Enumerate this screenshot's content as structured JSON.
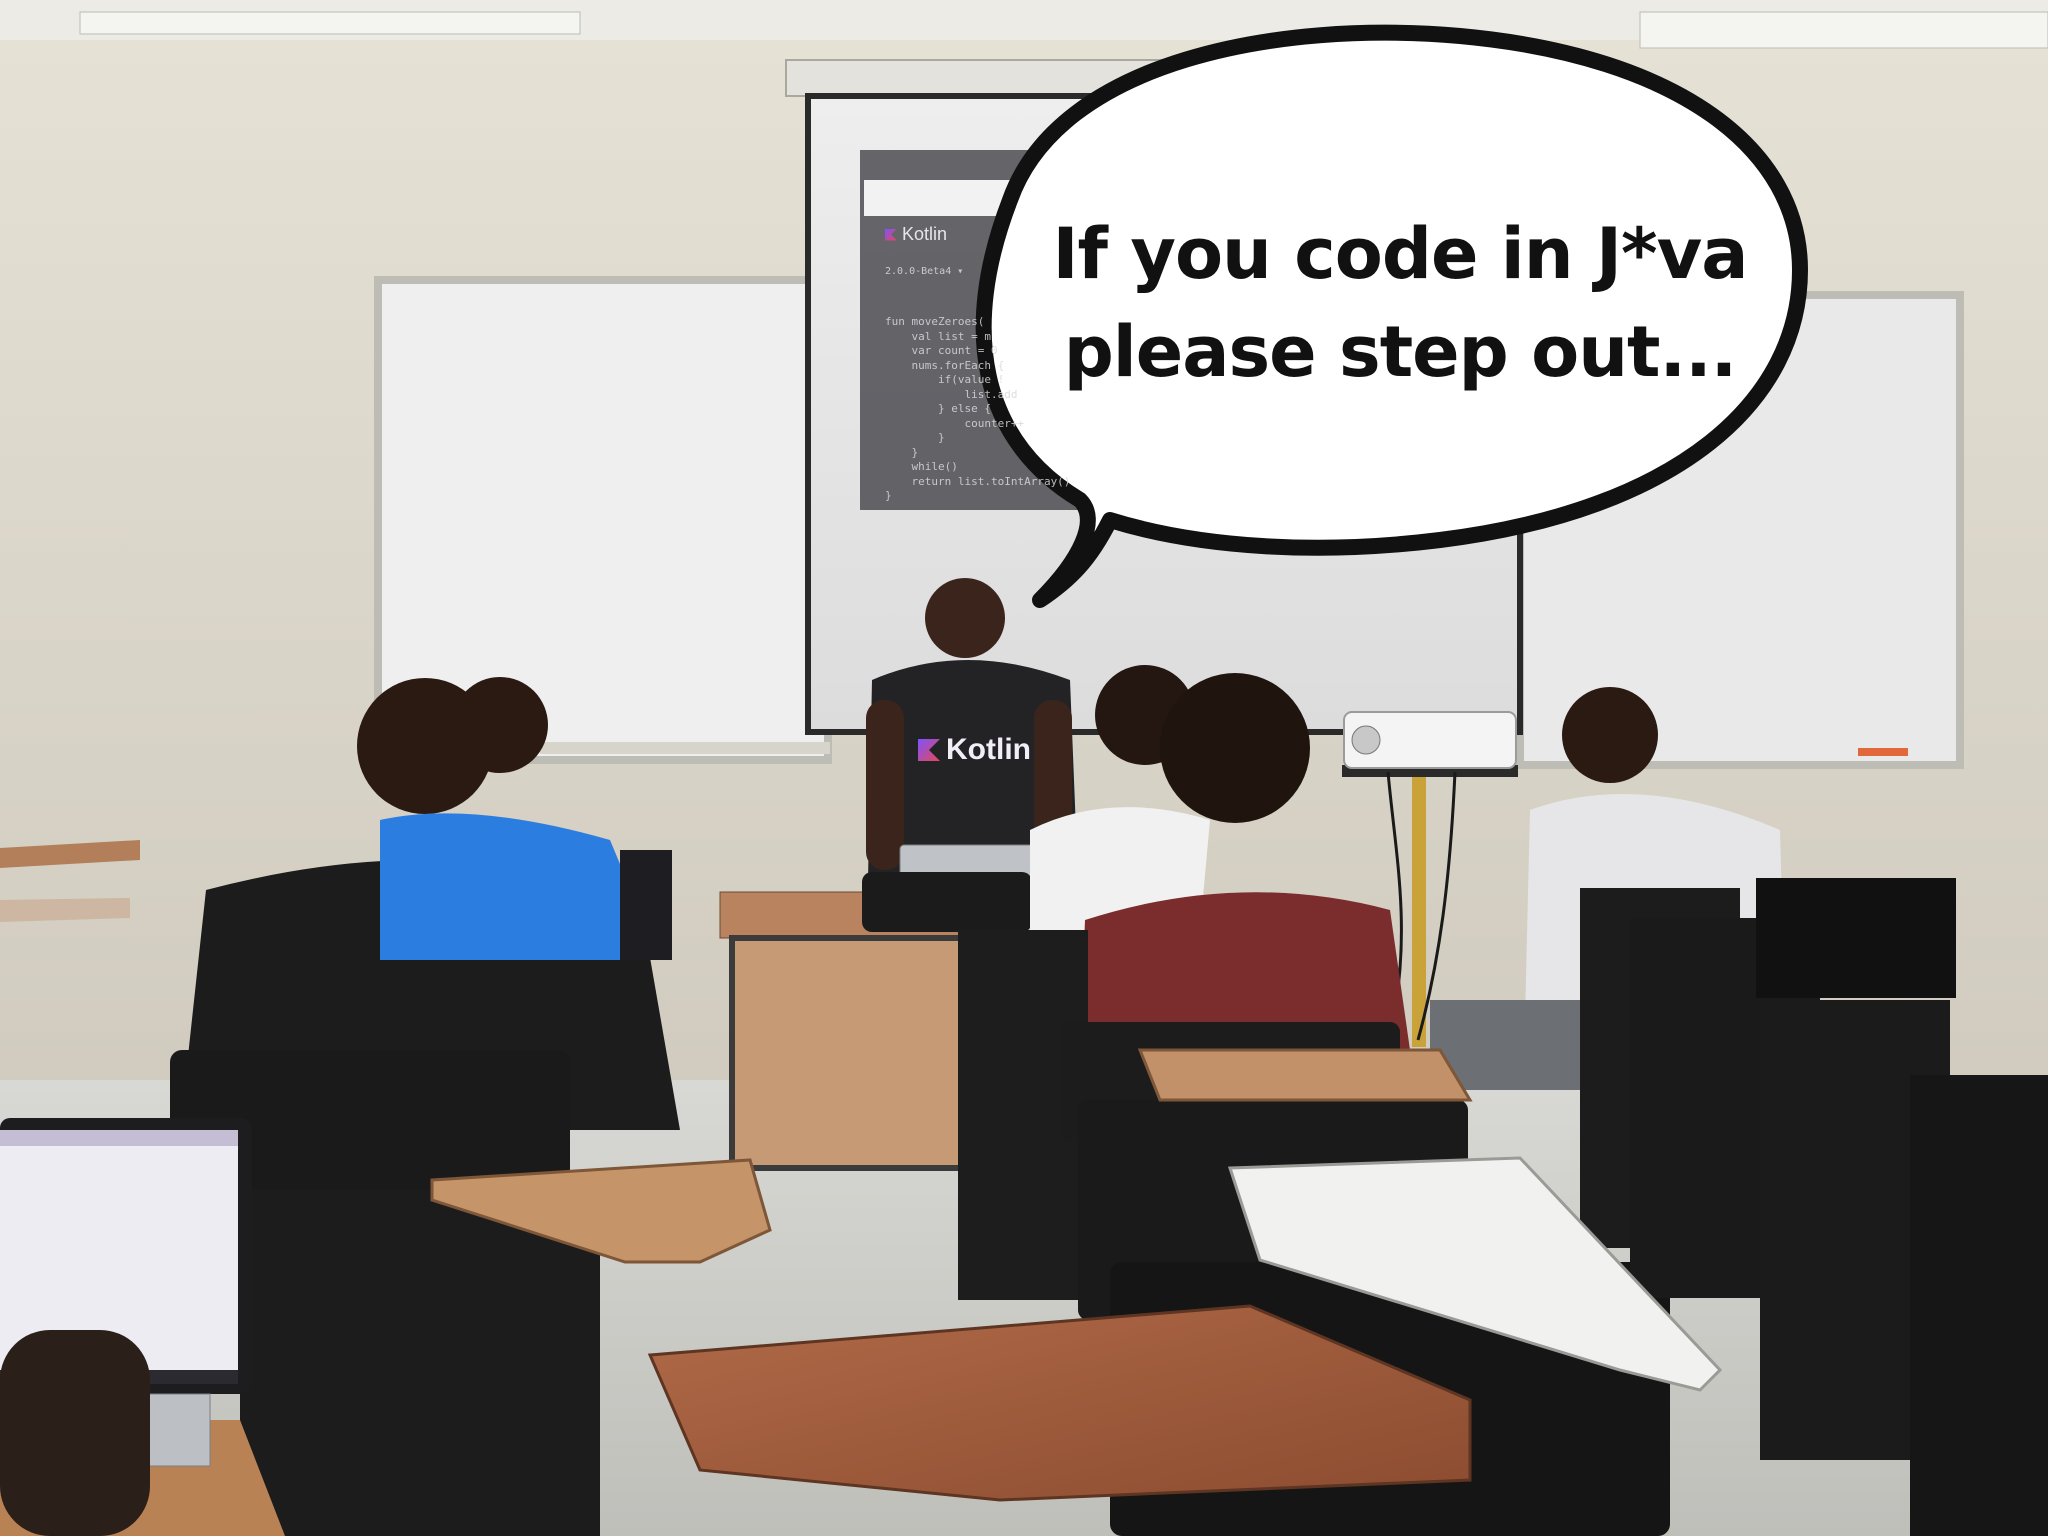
{
  "meme_caption": {
    "line1": "If you code in J*va",
    "line2": "please step out..."
  },
  "shirt": {
    "logo_text": "Kotlin"
  },
  "projected_screen": {
    "logo_text": "Kotlin",
    "version_text": "2.0.0-Beta4 ▾",
    "code_lines": [
      "fun moveZeroes(",
      "    val list = m",
      "    var count = 0",
      "    nums.forEach {",
      "        if(value !",
      "            list.add",
      "        } else {",
      "            counter++",
      "        }",
      "    }",
      "    while()",
      "    return list.toIntArray()",
      "}"
    ]
  },
  "colors": {
    "wall": "#d9d5c8",
    "bubble_fill": "#ffffff",
    "bubble_outline": "#111111",
    "desk_wood": "#9a5a3c",
    "kotlin_purple": "#7f52ff"
  }
}
